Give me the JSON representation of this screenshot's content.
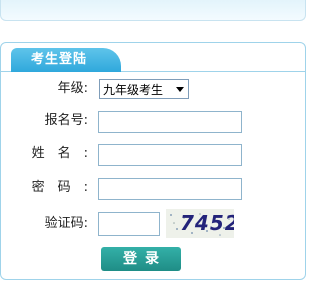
{
  "login": {
    "tab_title": "考生登陆",
    "grade_label": "年级:",
    "grade_value": "九年级考生",
    "reg_label": "报名号:",
    "name_label": "姓名:",
    "password_label": "密码:",
    "captcha_label": "验证码:",
    "captcha_text": "7452",
    "login_button": "登录"
  },
  "colors": {
    "tab": "#2fa8dc",
    "border": "#9fd3ea",
    "button": "#1f8d86",
    "captcha_text": "#23237a"
  }
}
